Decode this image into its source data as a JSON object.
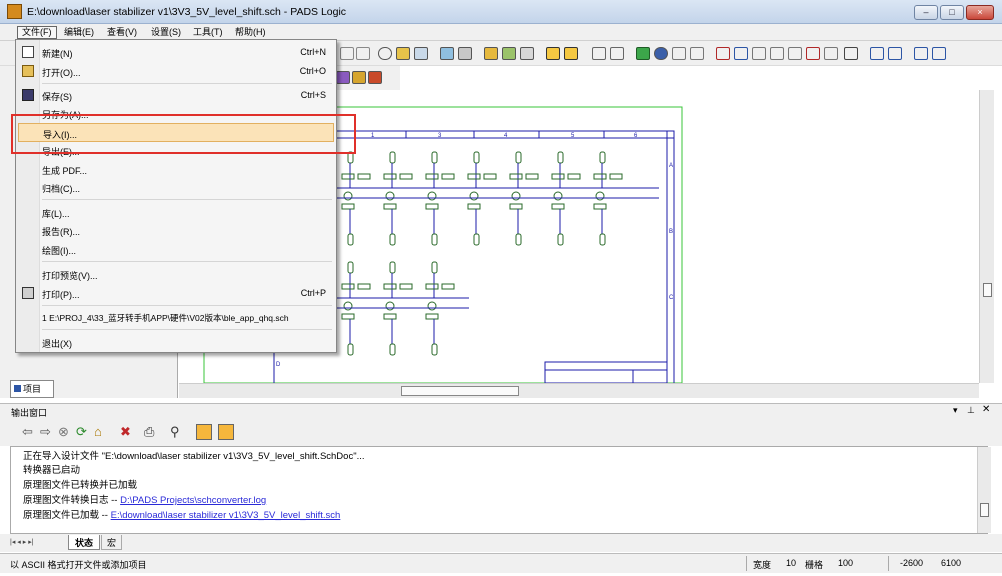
{
  "window": {
    "title": "E:\\download\\laser stabilizer v1\\3V3_5V_level_shift.sch - PADS Logic",
    "minimize": "–",
    "maximize": "□",
    "close": "×"
  },
  "menubar": [
    {
      "label": "文件(F)",
      "active": true
    },
    {
      "label": "编辑(E)"
    },
    {
      "label": "查看(V)"
    },
    {
      "label": "设置(S)"
    },
    {
      "label": "工具(T)"
    },
    {
      "label": "帮助(H)"
    }
  ],
  "file_menu": [
    {
      "label": "新建(N)",
      "shortcut": "Ctrl+N",
      "icon": "new-file-icon"
    },
    {
      "label": "打开(O)...",
      "shortcut": "Ctrl+O",
      "icon": "open-folder-icon"
    },
    {
      "label": "保存(S)",
      "shortcut": "Ctrl+S",
      "icon": "save-icon"
    },
    {
      "label": "另存为(A)..."
    },
    {
      "label": "导入(I)...",
      "highlighted": true
    },
    {
      "label": "导出(E)..."
    },
    {
      "label": "生成 PDF..."
    },
    {
      "label": "归档(C)..."
    },
    {
      "label": "库(L)..."
    },
    {
      "label": "报告(R)..."
    },
    {
      "label": "绘图(I)..."
    },
    {
      "label": "打印预览(V)..."
    },
    {
      "label": "打印(P)...",
      "shortcut": "Ctrl+P",
      "icon": "print-icon"
    },
    {
      "label": "1 E:\\PROJ_4\\33_蓝牙转手机APP\\硬件\\V02版本\\ble_app_qhq.sch"
    },
    {
      "label": "退出(X)"
    }
  ],
  "left_panel": {
    "project_tab": "项目"
  },
  "schematic": {
    "column_numbers": [
      "1",
      "2",
      "3",
      "4",
      "5",
      "6"
    ],
    "row_letters": [
      "A",
      "B",
      "C",
      "D"
    ]
  },
  "output": {
    "title": "输出窗口",
    "lines": [
      {
        "text": "正在导入设计文件 \"E:\\download\\laser stabilizer v1\\3V3_5V_level_shift.SchDoc\"..."
      },
      {
        "text": "转换器已启动"
      },
      {
        "text": "原理图文件已转换并已加载"
      },
      {
        "text": "原理图文件转换日志 -- ",
        "link": "D:\\PADS Projects\\schconverter.log"
      },
      {
        "text": "原理图文件已加载 -- ",
        "link": "E:\\download\\laser stabilizer v1\\3V3_5V_level_shift.sch"
      }
    ],
    "tabs": [
      {
        "label": "状态",
        "active": true
      },
      {
        "label": "宏"
      }
    ]
  },
  "statusbar": {
    "message": "以 ASCII 格式打开文件或添加项目",
    "width_label": "宽度",
    "width_value": "10",
    "grid_label": "栅格",
    "grid_value": "100",
    "x": "-2600",
    "y": "6100"
  },
  "colors": {
    "highlight_fill": "#fbe3b8",
    "annotation_red": "#e0302a",
    "link_blue": "#2a2ad8",
    "schematic_blue": "#1b1ba8",
    "component_green": "#2a6a2a",
    "board_outline_green": "#39c439"
  }
}
